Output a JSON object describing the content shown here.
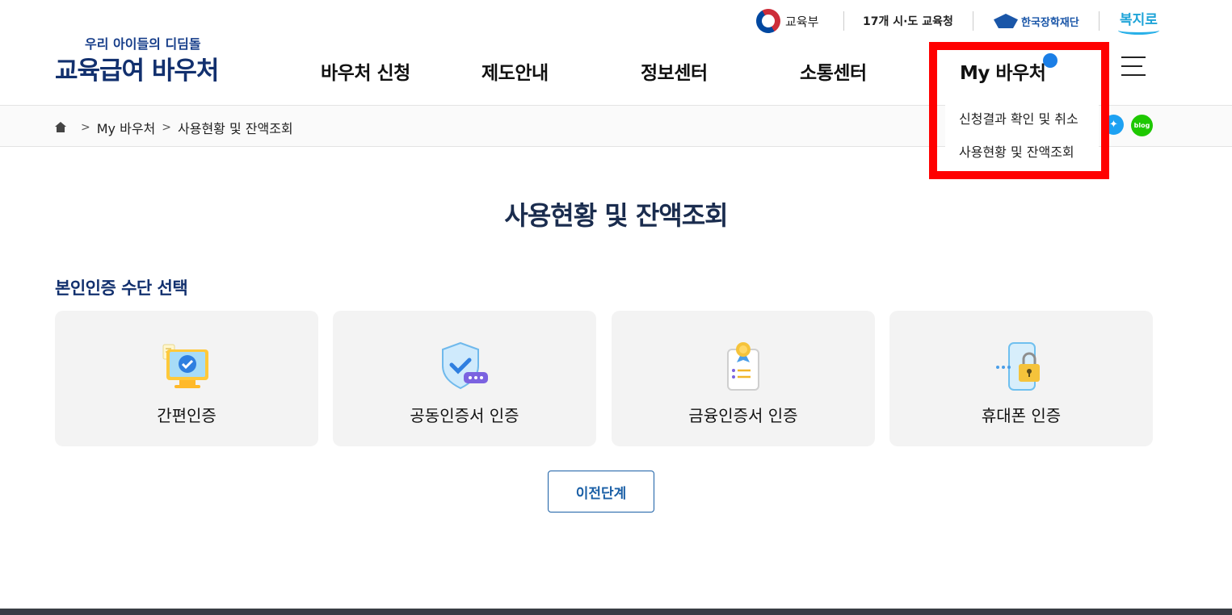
{
  "utility": {
    "moe": "교육부",
    "offices": "17개 시·도 교육청",
    "kosaf": "한국장학재단",
    "bokjiro": "복지로"
  },
  "logo": {
    "sub": "우리 아이들의 디딤돌",
    "main": "교육급여 바우처"
  },
  "gnb": {
    "items": [
      {
        "label": "바우처 신청"
      },
      {
        "label": "제도안내"
      },
      {
        "label": "정보센터"
      },
      {
        "label": "소통센터"
      },
      {
        "label": "My 바우처"
      }
    ]
  },
  "dropdown": {
    "items": [
      {
        "label": "신청결과 확인 및 취소"
      },
      {
        "label": "사용현황 및 잔액조회"
      }
    ],
    "highlight_color": "#ff0000"
  },
  "breadcrumb": {
    "items": [
      "My 바우처",
      "사용현황 및 잔액조회"
    ]
  },
  "share": {
    "blog": "blog"
  },
  "main": {
    "title": "사용현황 및 잔액조회",
    "section_title": "본인인증 수단 선택",
    "cards": [
      {
        "label": "간편인증",
        "icon": "monitor-check-icon"
      },
      {
        "label": "공동인증서 인증",
        "icon": "shield-check-icon"
      },
      {
        "label": "금융인증서 인증",
        "icon": "certificate-icon"
      },
      {
        "label": "휴대폰 인증",
        "icon": "phone-lock-icon"
      }
    ],
    "prev_button": "이전단계"
  },
  "colors": {
    "brand_navy": "#12306e",
    "accent_blue": "#1a5fa6",
    "dot_blue": "#1b7ee6"
  }
}
